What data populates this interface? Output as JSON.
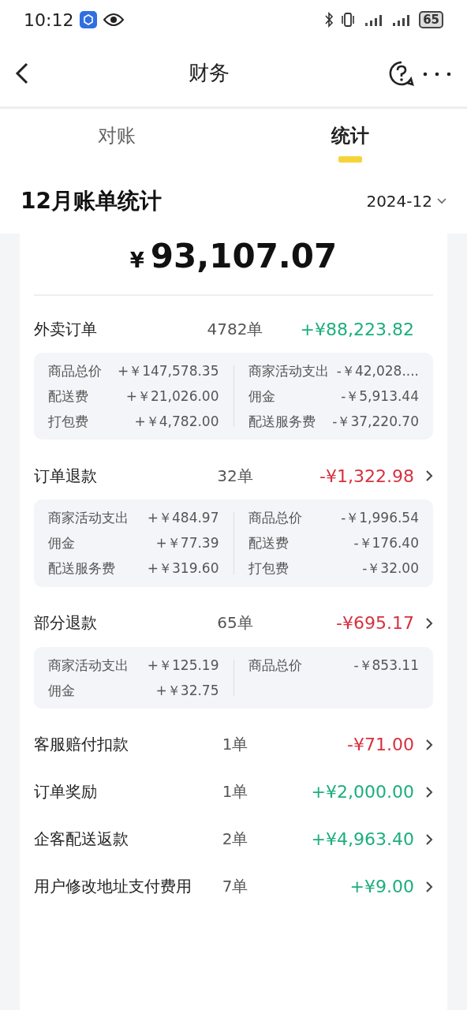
{
  "status_bar": {
    "time": "10:12",
    "battery": "65"
  },
  "nav": {
    "title": "财务"
  },
  "tabs": [
    {
      "label": "对账",
      "selected": false
    },
    {
      "label": "统计",
      "selected": true
    }
  ],
  "header": {
    "title": "12月账单统计",
    "month": "2024-12"
  },
  "total": {
    "currency": "¥",
    "amount": "93,107.07"
  },
  "sections": [
    {
      "name": "外卖订单",
      "count": "4782单",
      "amount": "+¥88,223.82",
      "color": "#1cae7e",
      "has_arrow": false,
      "left": [
        {
          "label": "商品总价",
          "value": "+￥147,578.35"
        },
        {
          "label": "配送费",
          "value": "+￥21,026.00"
        },
        {
          "label": "打包费",
          "value": "+￥4,782.00"
        }
      ],
      "right": [
        {
          "label": "商家活动支出",
          "value": "-￥42,028...."
        },
        {
          "label": "佣金",
          "value": "-￥5,913.44"
        },
        {
          "label": "配送服务费",
          "value": "-￥37,220.70"
        }
      ]
    },
    {
      "name": "订单退款",
      "count": "32单",
      "amount": "-¥1,322.98",
      "color": "#d8303e",
      "has_arrow": true,
      "left": [
        {
          "label": "商家活动支出",
          "value": "+￥484.97"
        },
        {
          "label": "佣金",
          "value": "+￥77.39"
        },
        {
          "label": "配送服务费",
          "value": "+￥319.60"
        }
      ],
      "right": [
        {
          "label": "商品总价",
          "value": "-￥1,996.54"
        },
        {
          "label": "配送费",
          "value": "-￥176.40"
        },
        {
          "label": "打包费",
          "value": "-￥32.00"
        }
      ]
    },
    {
      "name": "部分退款",
      "count": "65单",
      "amount": "-¥695.17",
      "color": "#d8303e",
      "has_arrow": true,
      "left": [
        {
          "label": "商家活动支出",
          "value": "+￥125.19"
        },
        {
          "label": "佣金",
          "value": "+￥32.75"
        }
      ],
      "right": [
        {
          "label": "商品总价",
          "value": "-￥853.11"
        }
      ]
    },
    {
      "name": "客服赔付扣款",
      "count": "1单",
      "amount": "-¥71.00",
      "color": "#d8303e",
      "has_arrow": true
    },
    {
      "name": "订单奖励",
      "count": "1单",
      "amount": "+¥2,000.00",
      "color": "#1cae7e",
      "has_arrow": true
    },
    {
      "name": "企客配送返款",
      "count": "2单",
      "amount": "+¥4,963.40",
      "color": "#1cae7e",
      "has_arrow": true
    },
    {
      "name": "用户修改地址支付费用",
      "count": "7单",
      "amount": "+¥9.00",
      "color": "#1cae7e",
      "has_arrow": true
    }
  ]
}
